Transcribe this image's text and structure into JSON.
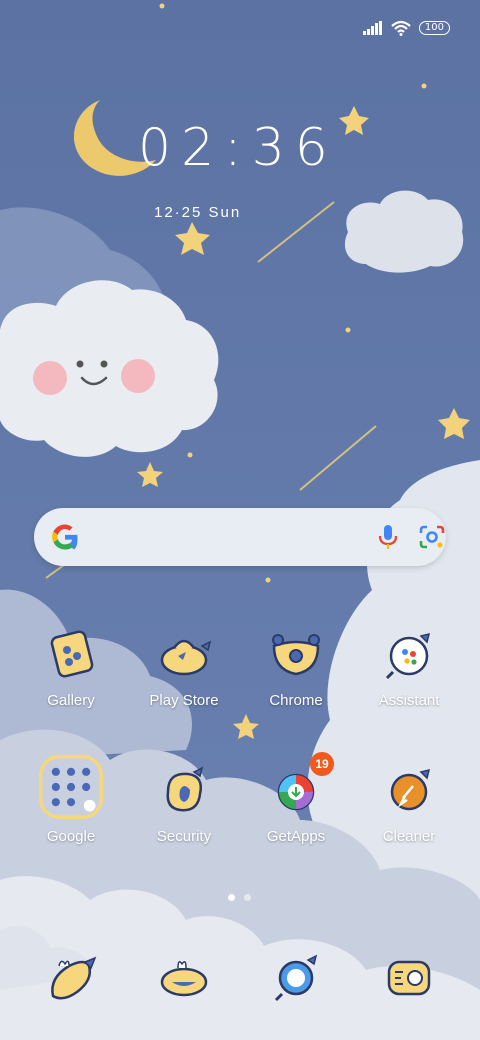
{
  "status_bar": {
    "battery": "100",
    "signal_icon": "signal-icon",
    "wifi_icon": "wifi-icon"
  },
  "clock": {
    "time": "02:36",
    "date": "12·25  Sun"
  },
  "search": {
    "logo": "google-g-icon",
    "mic": "mic-icon",
    "lens": "lens-camera-icon"
  },
  "apps": [
    {
      "label": "Gallery",
      "icon": "gallery-icon"
    },
    {
      "label": "Play Store",
      "icon": "play-store-icon"
    },
    {
      "label": "Chrome",
      "icon": "chrome-icon"
    },
    {
      "label": "Assistant",
      "icon": "assistant-icon"
    },
    {
      "label": "Google",
      "icon": "google-folder-icon"
    },
    {
      "label": "Security",
      "icon": "security-icon"
    },
    {
      "label": "GetApps",
      "icon": "getapps-icon",
      "badge": "19"
    },
    {
      "label": "Cleaner",
      "icon": "cleaner-icon"
    }
  ],
  "dock": [
    {
      "icon": "phone-icon"
    },
    {
      "icon": "messages-icon"
    },
    {
      "icon": "browser-icon"
    },
    {
      "icon": "camera-icon"
    }
  ],
  "page_indicator": {
    "pages": 2,
    "current": 1
  },
  "colors": {
    "sky": "#5a73a3",
    "cloud": "#e6e9ef",
    "star": "#f2d27a",
    "icon_fill": "#f6d77e",
    "icon_outline": "#2b3a66",
    "badge": "#f05a1e"
  }
}
